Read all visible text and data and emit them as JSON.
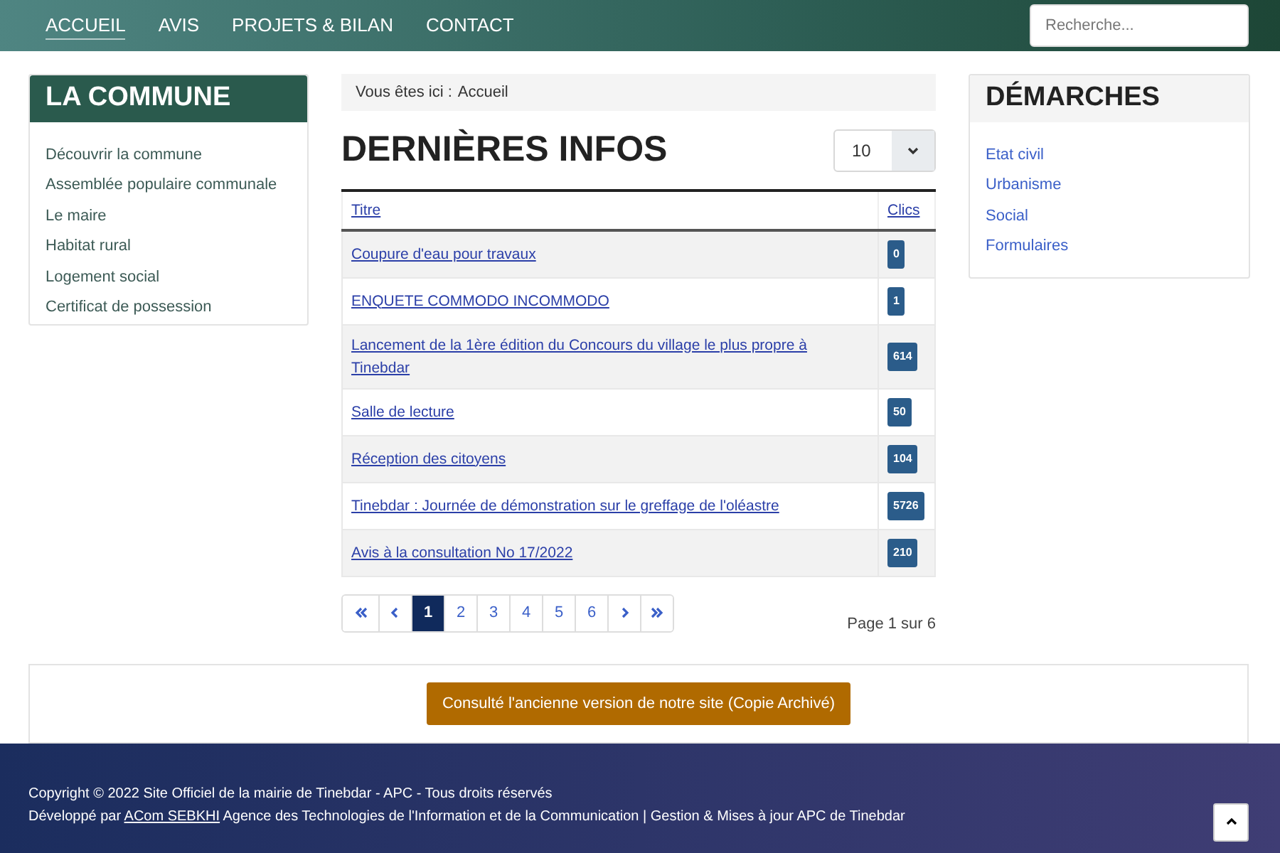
{
  "nav": {
    "items": [
      {
        "label": "ACCUEIL",
        "selected": true
      },
      {
        "label": "AVIS",
        "selected": false
      },
      {
        "label": "PROJETS & BILAN",
        "selected": false
      },
      {
        "label": "CONTACT",
        "selected": false
      }
    ],
    "search": {
      "placeholder": "Recherche..."
    }
  },
  "sidebar": {
    "title": "LA COMMUNE",
    "items": [
      "Découvrir la commune",
      "Assemblée populaire communale",
      "Le maire",
      "Habitat rural",
      "Logement social",
      "Certificat de possession"
    ]
  },
  "breadcrumb": {
    "label": "Vous êtes ici :",
    "current": "Accueil"
  },
  "main": {
    "title": "DERNIÈRES INFOS",
    "page_size": "10"
  },
  "table": {
    "columns": [
      "Titre",
      "Clics"
    ],
    "rows": [
      {
        "title": "Coupure d'eau pour travaux",
        "clicks": "0"
      },
      {
        "title": "ENQUETE COMMODO INCOMMODO",
        "clicks": "1"
      },
      {
        "title": "Lancement de la 1ère édition du Concours du village le plus propre à Tinebdar",
        "clicks": "614"
      },
      {
        "title": "Salle de lecture",
        "clicks": "50"
      },
      {
        "title": "Réception des citoyens",
        "clicks": "104"
      },
      {
        "title": "Tinebdar : Journée de démonstration sur le greffage de l'oléastre",
        "clicks": "5726"
      },
      {
        "title": "Avis à la consultation No 17/2022",
        "clicks": "210"
      }
    ]
  },
  "pagination": {
    "items": [
      {
        "kind": "first",
        "selected": false
      },
      {
        "kind": "prev",
        "selected": false
      },
      {
        "kind": "page",
        "label": "1",
        "selected": true
      },
      {
        "kind": "page",
        "label": "2",
        "selected": false
      },
      {
        "kind": "page",
        "label": "3",
        "selected": false
      },
      {
        "kind": "page",
        "label": "4",
        "selected": false
      },
      {
        "kind": "page",
        "label": "5",
        "selected": false
      },
      {
        "kind": "page",
        "label": "6",
        "selected": false
      },
      {
        "kind": "next",
        "selected": false
      },
      {
        "kind": "last",
        "selected": false
      }
    ],
    "status": "Page 1 sur 6"
  },
  "demarches": {
    "title": "DÉMARCHES",
    "items": [
      "Etat civil",
      "Urbanisme",
      "Social",
      "Formulaires"
    ]
  },
  "archive_button": "Consulté l'ancienne version de notre site (Copie Archivé)",
  "footer": {
    "copyright": "Copyright © 2022 Site Officiel de la mairie de Tinebdar - APC - Tous droits réservés",
    "credit_prefix": "Développé par",
    "credit_link": "ACom SEBKHI",
    "credit_suffix": "Agence des Technologies de l'Information et de la Communication | Gestion & Mises à jour APC de Tinebdar"
  }
}
